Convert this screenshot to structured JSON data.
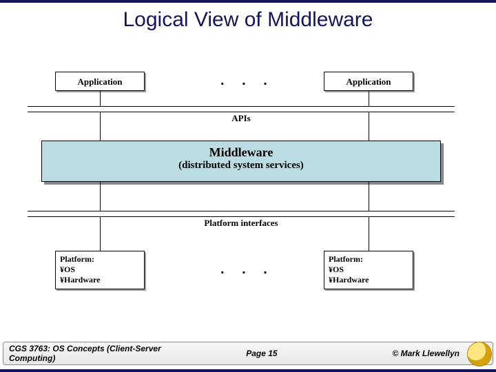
{
  "title": "Logical View of Middleware",
  "diagram": {
    "app_left": "Application",
    "app_right": "Application",
    "dots": ". . .",
    "apis_label": "APIs",
    "middleware_line1": "Middleware",
    "middleware_line2": "(distributed system services)",
    "platform_interfaces_label": "Platform interfaces",
    "platform_left": "Platform:\n¥OS\n¥Hardware",
    "platform_right": "Platform:\n¥OS\n¥Hardware"
  },
  "footer": {
    "course": "CGS 3763: OS Concepts  (Client-Server Computing)",
    "page": "Page 15",
    "copyright": "© Mark Llewellyn"
  }
}
